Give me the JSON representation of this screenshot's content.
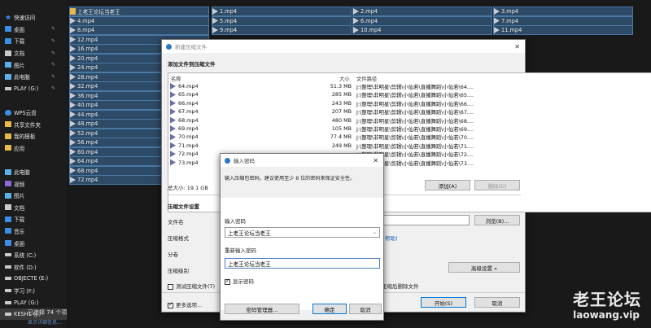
{
  "explorer": {
    "nav_items": [
      {
        "label": "快速访问",
        "icon": "star-icon",
        "color": "#3a8ee6",
        "pin": false
      },
      {
        "label": "桌面",
        "icon": "desktop-icon",
        "color": "#3a8ee6",
        "pin": true
      },
      {
        "label": "下载",
        "icon": "download-icon",
        "color": "#3a8ee6",
        "pin": true
      },
      {
        "label": "文档",
        "icon": "document-icon",
        "color": "#c9c9c9",
        "pin": true
      },
      {
        "label": "图片",
        "icon": "picture-icon",
        "color": "#5ab0e8",
        "pin": true
      },
      {
        "label": "此电脑",
        "icon": "computer-icon",
        "color": "#5ab0e8",
        "pin": true
      },
      {
        "label": "PLAY (G:)",
        "icon": "drive-icon",
        "color": "#c9c9c9",
        "pin": true
      },
      {
        "label": "",
        "icon": "",
        "color": "",
        "pin": false
      },
      {
        "label": "WPS云盘",
        "icon": "cloud-icon",
        "color": "#3a8ee6",
        "pin": false
      },
      {
        "label": "共享文件夹",
        "icon": "folder-icon",
        "color": "#e8b84a",
        "pin": false
      },
      {
        "label": "我的模板",
        "icon": "folder-icon",
        "color": "#e8b84a",
        "pin": false
      },
      {
        "label": "应用",
        "icon": "folder-icon",
        "color": "#e8b84a",
        "pin": false
      },
      {
        "label": "",
        "icon": "",
        "color": "",
        "pin": false
      },
      {
        "label": "此电脑",
        "icon": "computer-icon",
        "color": "#5ab0e8",
        "pin": false
      },
      {
        "label": "视频",
        "icon": "video-icon",
        "color": "#8e66d6",
        "pin": false
      },
      {
        "label": "图片",
        "icon": "picture-icon",
        "color": "#5ab0e8",
        "pin": false
      },
      {
        "label": "文档",
        "icon": "document-icon",
        "color": "#c9c9c9",
        "pin": false
      },
      {
        "label": "下载",
        "icon": "download-icon",
        "color": "#3a8ee6",
        "pin": false
      },
      {
        "label": "音乐",
        "icon": "music-icon",
        "color": "#3a8ee6",
        "pin": false
      },
      {
        "label": "桌面",
        "icon": "desktop-icon",
        "color": "#3a8ee6",
        "pin": false
      },
      {
        "label": "系统 (C:)",
        "icon": "drive-icon",
        "color": "#c9c9c9",
        "pin": false
      },
      {
        "label": "软件 (D:)",
        "icon": "drive-icon",
        "color": "#c9c9c9",
        "pin": false
      },
      {
        "label": "OBJECTE (E:)",
        "icon": "drive-icon",
        "color": "#c9c9c9",
        "pin": false
      },
      {
        "label": "学习 (F:)",
        "icon": "drive-icon",
        "color": "#c9c9c9",
        "pin": false
      },
      {
        "label": "PLAY (G:)",
        "icon": "drive-icon",
        "color": "#c9c9c9",
        "pin": false
      },
      {
        "label": "KESH1 (J:)",
        "icon": "drive-icon",
        "color": "#c9c9c9",
        "pin": false,
        "selected": true
      }
    ],
    "grid": [
      [
        "上老王论坛当老王",
        "1.mp4",
        "2.mp4",
        "3.mp4"
      ],
      [
        "4.mp4",
        "5.mp4",
        "6.mp4",
        "7.mp4"
      ],
      [
        "8.mp4",
        "9.mp4",
        "10.mp4",
        "11.mp4"
      ],
      [
        "12.mp4",
        "",
        "",
        ""
      ],
      [
        "16.mp4",
        "",
        "",
        ""
      ],
      [
        "20.mp4",
        "",
        "",
        ""
      ],
      [
        "24.mp4",
        "",
        "",
        ""
      ],
      [
        "28.mp4",
        "",
        "",
        ""
      ],
      [
        "32.mp4",
        "",
        "",
        ""
      ],
      [
        "36.mp4",
        "",
        "",
        ""
      ],
      [
        "40.mp4",
        "",
        "",
        ""
      ],
      [
        "44.mp4",
        "",
        "",
        ""
      ],
      [
        "48.mp4",
        "",
        "",
        ""
      ],
      [
        "52.mp4",
        "",
        "",
        ""
      ],
      [
        "56.mp4",
        "",
        "",
        ""
      ],
      [
        "60.mp4",
        "",
        "",
        ""
      ],
      [
        "64.mp4",
        "",
        "",
        ""
      ],
      [
        "68.mp4",
        "",
        "",
        ""
      ],
      [
        "72.mp4",
        "",
        "",
        ""
      ]
    ],
    "status_text": "已选择 74 个项",
    "status_sub": "显示详细信息..."
  },
  "zip_dialog": {
    "title": "新建压缩文件",
    "section_add": "添加文件到压缩文件",
    "headers": {
      "name": "名称",
      "size": "大小",
      "path": "文件路径"
    },
    "files": [
      {
        "name": "64.mp4",
        "size": "51.3 MB",
        "path": "J:\\整理\\非明星\\剪辑\\小仙若\\直播舞蹈\\小仙若\\64...."
      },
      {
        "name": "65.mp4",
        "size": "285 MB",
        "path": "J:\\整理\\非明星\\剪辑\\小仙若\\直播舞蹈\\小仙若\\65...."
      },
      {
        "name": "66.mp4",
        "size": "243 MB",
        "path": "J:\\整理\\非明星\\剪辑\\小仙若\\直播舞蹈\\小仙若\\66...."
      },
      {
        "name": "67.mp4",
        "size": "207 MB",
        "path": "J:\\整理\\非明星\\剪辑\\小仙若\\直播舞蹈\\小仙若\\67...."
      },
      {
        "name": "68.mp4",
        "size": "480 MB",
        "path": "J:\\整理\\非明星\\剪辑\\小仙若\\直播舞蹈\\小仙若\\68...."
      },
      {
        "name": "69.mp4",
        "size": "105 MB",
        "path": "J:\\整理\\非明星\\剪辑\\小仙若\\直播舞蹈\\小仙若\\69...."
      },
      {
        "name": "70.mp4",
        "size": "77.4 MB",
        "path": "J:\\整理\\非明星\\剪辑\\小仙若\\直播舞蹈\\小仙若\\70...."
      },
      {
        "name": "71.mp4",
        "size": "249 MB",
        "path": "J:\\整理\\非明星\\剪辑\\小仙若\\直播舞蹈\\小仙若\\71...."
      },
      {
        "name": "72.mp4",
        "size": "",
        "path": "J:\\整理\\非明星\\剪辑\\小仙若\\直播舞蹈\\小仙若\\72...."
      },
      {
        "name": "73.mp4",
        "size": "",
        "path": "J:\\整理\\非明星\\剪辑\\小仙若\\直播舞蹈\\小仙若\\73...."
      }
    ],
    "total": "总大小: 19.1 GB",
    "add_btn": "添加(A)",
    "delete_btn": "删除(D)",
    "section_settings": "压缩文件设置",
    "filename_label": "文件名",
    "format_label": "压缩格式",
    "volume_label": "分卷",
    "level_label": "压缩级别",
    "browse_btn": "浏览(B)...",
    "help_link": "帮助)",
    "advanced_btn": "高级设置 »",
    "test_label": "测试压缩文件(T)",
    "delete_after_label": "压缩后删除文件",
    "more_label": "更多选项...",
    "start_btn": "开始(S)",
    "cancel_btn": "取消"
  },
  "pwd_dialog": {
    "title": "输入密码",
    "hint": "输入压缩包密码。建议使用至少 8 位的密码来保证安全性。",
    "pwd_label": "输入密码",
    "pwd_value": "上老王论坛当老王",
    "repeat_label": "重新输入密码",
    "repeat_value": "上老王论坛当老王",
    "show_label": "显示密码",
    "manager_btn": "密码管理器...",
    "ok_btn": "确定",
    "cancel_btn": "取消"
  },
  "watermark": {
    "line1": "老王论坛",
    "line2": "laowang.vip"
  }
}
